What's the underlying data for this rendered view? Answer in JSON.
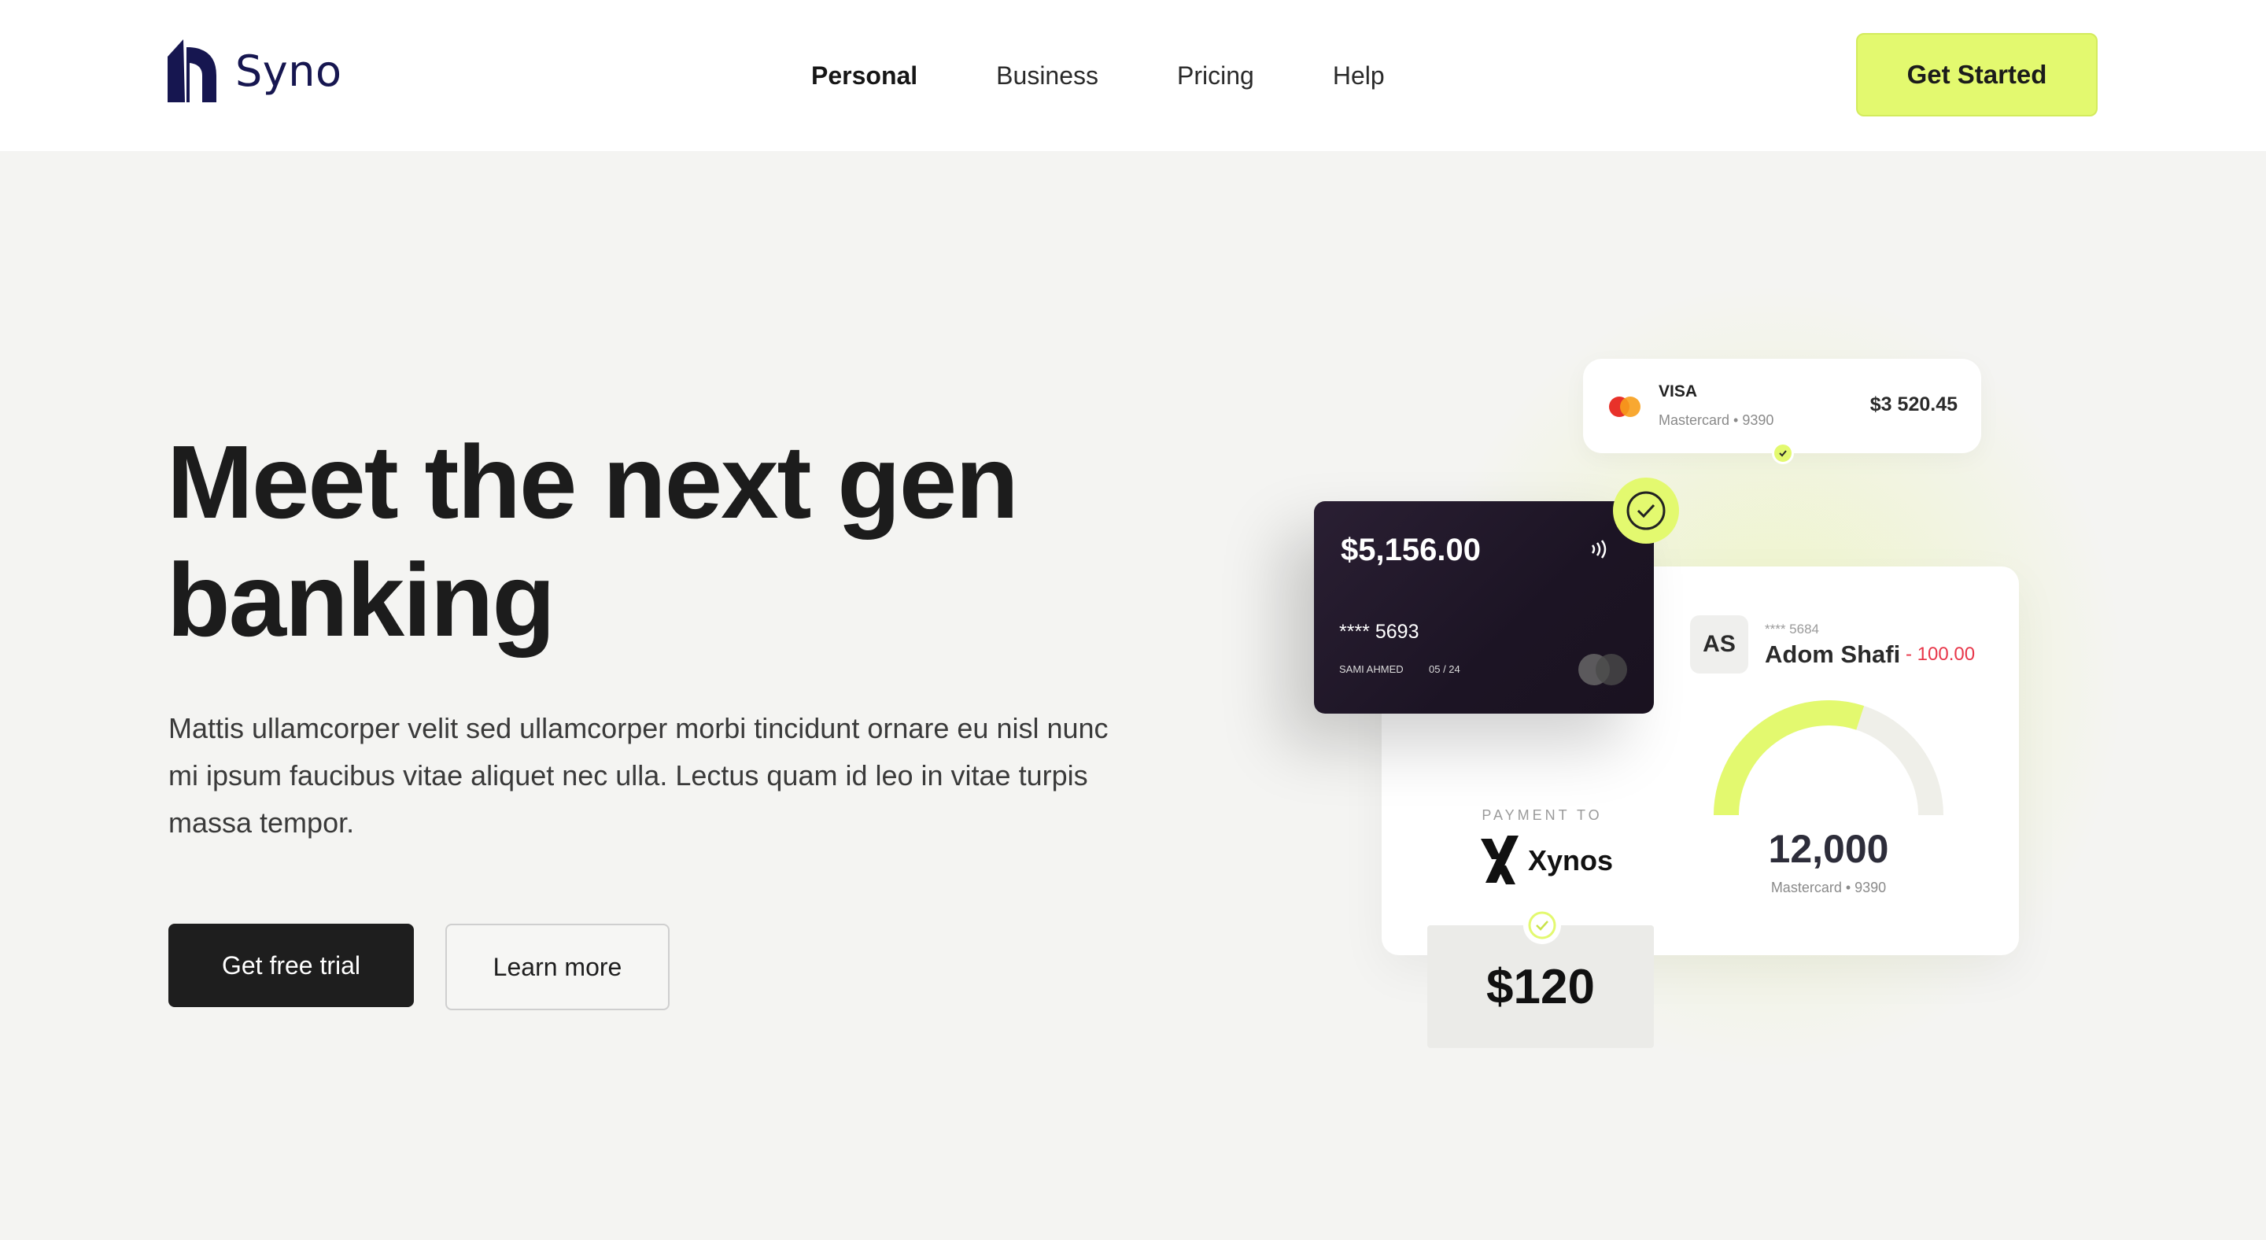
{
  "brand": {
    "name": "Syno",
    "logo_color": "#161650"
  },
  "nav": {
    "items": [
      {
        "label": "Personal",
        "active": true
      },
      {
        "label": "Business",
        "active": false
      },
      {
        "label": "Pricing",
        "active": false
      },
      {
        "label": "Help",
        "active": false
      }
    ],
    "cta_label": "Get Started"
  },
  "hero": {
    "headline": "Meet the next gen banking",
    "subtext": "Mattis ullamcorper velit sed ullamcorper morbi tincidunt ornare eu nisl nunc mi ipsum faucibus vitae aliquet nec ulla. Lectus quam id leo in vitae turpis massa tempor.",
    "primary_button": "Get free trial",
    "secondary_button": "Learn more"
  },
  "illustration": {
    "visa_card": {
      "title": "VISA",
      "subtitle": "Mastercard • 9390",
      "amount": "$3 520.45"
    },
    "dark_card": {
      "balance": "$5,156.00",
      "number": "**** 5693",
      "holder": "SAMI AHMED",
      "expiry": "05 / 24"
    },
    "transfer": {
      "initials": "AS",
      "card_number": "**** 5684",
      "name": "Adom Shafi",
      "delta": "- 100.00"
    },
    "gauge": {
      "value": "12,000",
      "subtitle": "Mastercard • 9390",
      "fill_fraction": 0.6
    },
    "payment": {
      "label": "PAYMENT TO",
      "merchant": "Xynos",
      "amount": "$120"
    }
  },
  "colors": {
    "accent": "#e3f96f",
    "dark_button": "#1e1e1e",
    "background": "#f4f4f2",
    "negative": "#e8374a"
  },
  "icons": {
    "logo": "syno-logo-icon",
    "check": "check-icon",
    "nfc": "contactless-icon",
    "mastercard": "mastercard-icon",
    "xynos": "xynos-logo-icon"
  }
}
